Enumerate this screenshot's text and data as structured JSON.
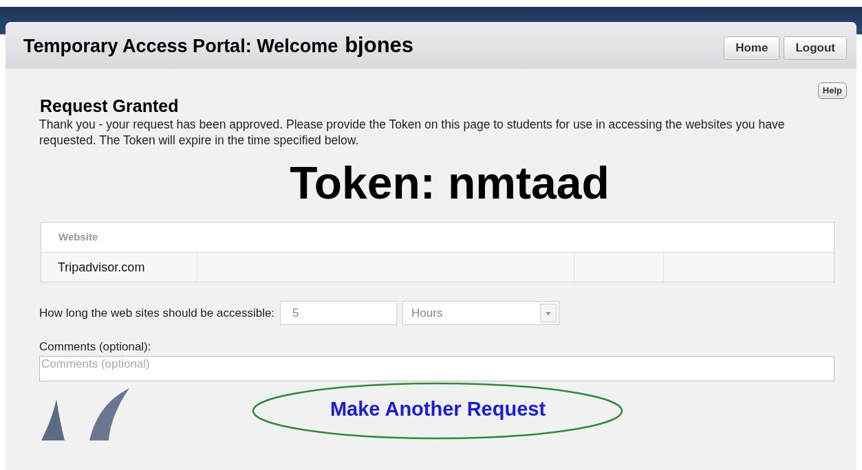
{
  "header": {
    "title": "Temporary Access Portal: Welcome",
    "user": "bjones",
    "buttons": [
      "Home",
      "Logout"
    ]
  },
  "help": "Help",
  "heading": "Request Granted",
  "message": "Thank you - your request has been approved. Please provide the Token on this page to students for use in accessing the websites you have requested. The Token will expire in the time specified below.",
  "token": "Token: nmtaad",
  "table": {
    "columns": [
      "Website"
    ],
    "rows": [
      [
        "Tripadvisor.com"
      ]
    ]
  },
  "duration": {
    "label": "How long the web sites should be accessible:",
    "value": "5",
    "unit": "Hours"
  },
  "comments": {
    "label": "Comments (optional):",
    "placeholder": "Comments (optional)"
  },
  "link": "Make Another Request"
}
